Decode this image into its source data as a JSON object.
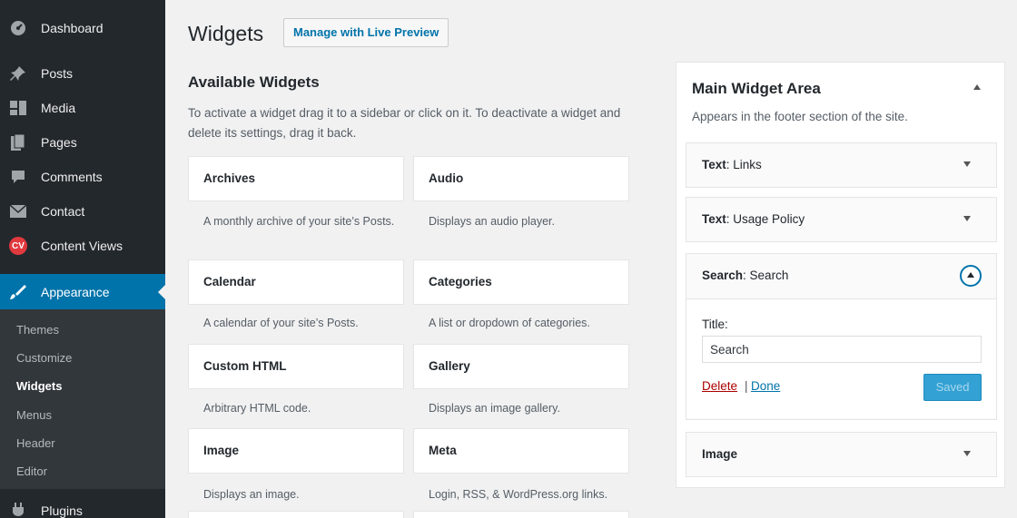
{
  "admin_menu": {
    "items": [
      {
        "label": "Dashboard",
        "icon": "dashboard-icon"
      },
      {
        "label": "Posts",
        "icon": "pushpin-icon"
      },
      {
        "label": "Media",
        "icon": "media-icon"
      },
      {
        "label": "Pages",
        "icon": "pages-icon"
      },
      {
        "label": "Comments",
        "icon": "comment-icon"
      },
      {
        "label": "Contact",
        "icon": "envelope-icon"
      },
      {
        "label": "Content Views",
        "icon": "content-views-icon",
        "badge": "CV"
      },
      {
        "label": "Appearance",
        "icon": "paintbrush-icon"
      },
      {
        "label": "Plugins",
        "icon": "plugin-icon"
      }
    ],
    "submenu": [
      "Themes",
      "Customize",
      "Widgets",
      "Menus",
      "Header",
      "Editor"
    ],
    "active_submenu": "Widgets"
  },
  "header": {
    "title": "Widgets",
    "live_preview_label": "Manage with Live Preview"
  },
  "available": {
    "heading": "Available Widgets",
    "description": "To activate a widget drag it to a sidebar or click on it. To deactivate a widget and delete its settings, drag it back.",
    "widgets": [
      {
        "title": "Archives",
        "desc": "A monthly archive of your site’s Posts."
      },
      {
        "title": "Audio",
        "desc": "Displays an audio player."
      },
      {
        "title": "Calendar",
        "desc": "A calendar of your site’s Posts."
      },
      {
        "title": "Categories",
        "desc": "A list or dropdown of categories."
      },
      {
        "title": "Custom HTML",
        "desc": "Arbitrary HTML code."
      },
      {
        "title": "Gallery",
        "desc": "Displays an image gallery."
      },
      {
        "title": "Image",
        "desc": "Displays an image."
      },
      {
        "title": "Meta",
        "desc": "Login, RSS, & WordPress.org links."
      }
    ]
  },
  "sidebar_area": {
    "title": "Main Widget Area",
    "description": "Appears in the footer section of the site.",
    "widgets": [
      {
        "type": "Text",
        "name": "Links"
      },
      {
        "type": "Text",
        "name": "Usage Policy"
      },
      {
        "type": "Search",
        "name": "Search"
      },
      {
        "type": "Image",
        "name": ""
      }
    ],
    "open_widget": {
      "field_label": "Title:",
      "field_value": "Search",
      "delete_label": "Delete",
      "separator": "|",
      "done_label": "Done",
      "saved_label": "Saved"
    }
  },
  "colors": {
    "menu_bg": "#23282d",
    "submenu_bg": "#32373c",
    "accent": "#0073aa",
    "delete": "#a00000"
  }
}
